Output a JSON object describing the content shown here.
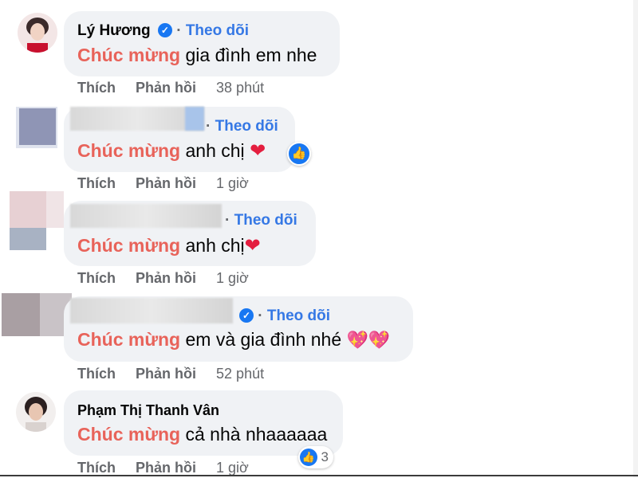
{
  "comments": [
    {
      "name": "Lý Hương",
      "verified": true,
      "follow": "Theo dõi",
      "highlight": "Chúc mừng",
      "text": "gia đình em nhe",
      "like": "Thích",
      "reply": "Phản hồi",
      "time": "38 phút"
    },
    {
      "name": "",
      "verified": false,
      "follow": "Theo dõi",
      "highlight": "Chúc mừng",
      "text": "anh chị",
      "emoji": "❤",
      "like": "Thích",
      "reply": "Phản hồi",
      "time": "1 giờ",
      "reaction_icon": "like-icon"
    },
    {
      "name": "",
      "verified": false,
      "follow": "Theo dõi",
      "highlight": "Chúc mừng",
      "text": "anh chị",
      "emoji": "❤",
      "like": "Thích",
      "reply": "Phản hồi",
      "time": "1 giờ"
    },
    {
      "name": "",
      "verified": true,
      "follow": "Theo dõi",
      "highlight": "Chúc mừng",
      "text": "em và gia đình nhé",
      "emoji": "💖💖",
      "like": "Thích",
      "reply": "Phản hồi",
      "time": "52 phút"
    },
    {
      "name": "Phạm Thị Thanh Vân",
      "verified": false,
      "highlight": "Chúc mừng",
      "text": "cả nhà nhaaaaaa",
      "like": "Thích",
      "reply": "Phản hồi",
      "time": "1 giờ",
      "reaction_count": "3",
      "reaction_icon": "like-icon"
    }
  ],
  "colors": {
    "highlight": "#e8635a",
    "follow": "#3578e5",
    "bubble": "#f0f2f5",
    "meta": "#65676b"
  }
}
